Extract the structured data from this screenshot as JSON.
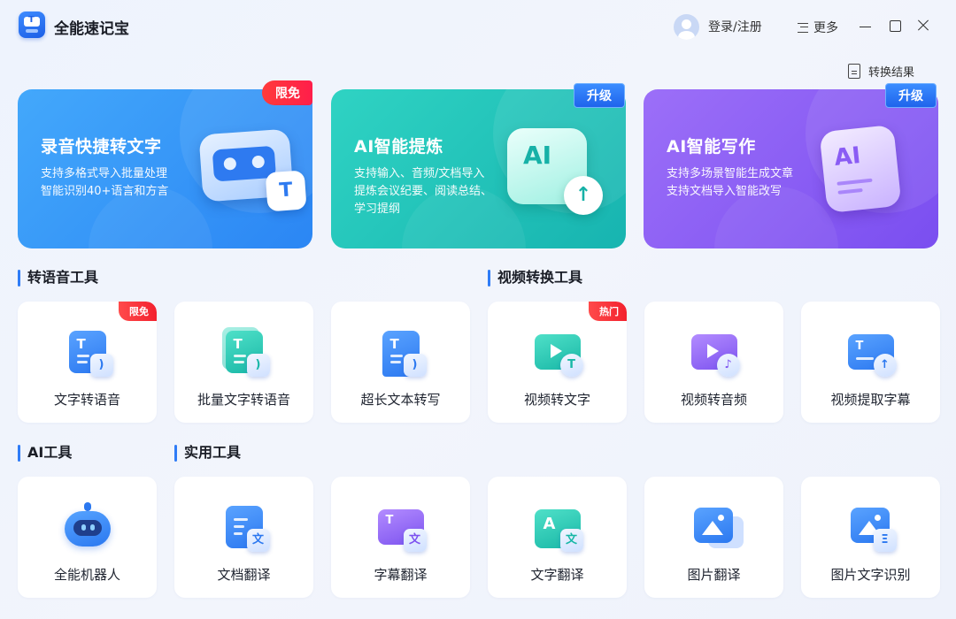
{
  "app": {
    "title": "全能速记宝"
  },
  "header": {
    "login_label": "登录/注册",
    "more_label": "更多"
  },
  "results_link": "转换结果",
  "banners": [
    {
      "title": "录音快捷转文字",
      "desc_line1": "支持多格式导入批量处理",
      "desc_line2": "智能识别40+语言和方言",
      "desc_line3": "",
      "badge": "限免",
      "color": "#2b86f4"
    },
    {
      "title": "AI智能提炼",
      "desc_line1": "支持输入、音频/文档导入",
      "desc_line2": "提炼会议纪要、阅读总结、",
      "desc_line3": "学习提纲",
      "badge": "升级",
      "color": "#17b4b0"
    },
    {
      "title": "AI智能写作",
      "desc_line1": "支持多场景智能生成文章",
      "desc_line2": "支持文档导入智能改写",
      "desc_line3": "",
      "badge": "升级",
      "color": "#7a4ef0"
    }
  ],
  "banner_art": {
    "b1_chip": "T",
    "b2_text": "AI",
    "b2_chip": "↑",
    "b3_text": "AI"
  },
  "sections": {
    "voice_tools": "转语音工具",
    "video_tools": "视频转换工具",
    "ai_tools": "AI工具",
    "utility_tools": "实用工具"
  },
  "tools_row1": [
    {
      "label": "文字转语音",
      "badge": "限免",
      "icon": "text-to-speech-icon",
      "glyph": "T"
    },
    {
      "label": "批量文字转语音",
      "badge": "",
      "icon": "batch-text-to-speech-icon",
      "glyph": "T"
    },
    {
      "label": "超长文本转写",
      "badge": "",
      "icon": "long-text-transcribe-icon",
      "glyph": "T"
    },
    {
      "label": "视频转文字",
      "badge": "热门",
      "icon": "video-to-text-icon",
      "glyph": "T"
    },
    {
      "label": "视频转音频",
      "badge": "",
      "icon": "video-to-audio-icon",
      "glyph": "♪"
    },
    {
      "label": "视频提取字幕",
      "badge": "",
      "icon": "video-subtitle-extract-icon",
      "glyph": "↑"
    }
  ],
  "tools_row2": [
    {
      "label": "全能机器人",
      "icon": "robot-icon",
      "glyph": ""
    },
    {
      "label": "文档翻译",
      "icon": "document-translate-icon",
      "glyph": "文"
    },
    {
      "label": "字幕翻译",
      "icon": "subtitle-translate-icon",
      "glyph": "文"
    },
    {
      "label": "文字翻译",
      "icon": "text-translate-icon",
      "glyph": "文"
    },
    {
      "label": "图片翻译",
      "icon": "image-translate-icon",
      "glyph": ""
    },
    {
      "label": "图片文字识别",
      "icon": "image-ocr-icon",
      "glyph": "Ξ"
    }
  ],
  "colors": {
    "accent": "#2f7cf6",
    "badge_red": "#f3212e",
    "teal": "#18b7a6",
    "purple": "#7c52ef"
  }
}
